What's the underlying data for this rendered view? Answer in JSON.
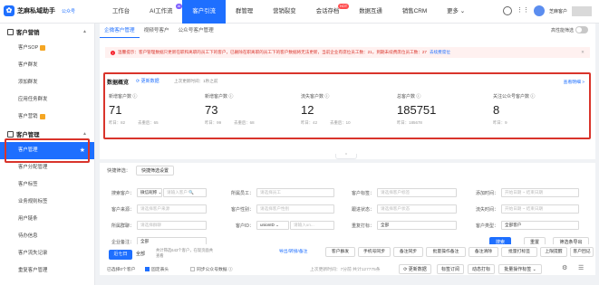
{
  "app": {
    "name": "芝麻私域助手",
    "subtitle": "公众号"
  },
  "nav": {
    "items": [
      {
        "label": "工作台"
      },
      {
        "label": "AI工作流",
        "badge": "AI"
      },
      {
        "label": "客户引流"
      },
      {
        "label": "群管理"
      },
      {
        "label": "营销裂变"
      },
      {
        "label": "会话存档",
        "badge": "HOT"
      },
      {
        "label": "数据互通"
      },
      {
        "label": "销售CRM"
      },
      {
        "label": "更多 ⌄"
      }
    ],
    "user_name": "芝麻客户"
  },
  "sidebar": {
    "group1": "客户营销",
    "group1_items": [
      "客户SOP",
      "客户群发",
      "添加群发",
      "应用任务群发",
      "客户营销"
    ],
    "group2": "客户管理",
    "group2_items": [
      "客户管理",
      "客户分配管理",
      "客户标签",
      "业务规则标签",
      "用户链条",
      "待办信息",
      "客户流失记录",
      "重复客户管理"
    ]
  },
  "tabs": [
    "企微客户管理",
    "视频号客户",
    "公众号客户管理"
  ],
  "toggle_label": "高性能筛选",
  "notice": {
    "text": "温馨提示：客户管理数据只更新在职和离职的员工下的客户，已删除在职离职的员工下的客户数据将无法更新，当前企业有席位员工数：21，到期未续费席位员工数：27",
    "link": "去续费席位"
  },
  "stats": {
    "title": "数据概览",
    "refresh": "更新数据",
    "updated": "上次更新时间：1秒之前",
    "view_more": "查看明细 >",
    "cards": [
      {
        "label": "新增客户数",
        "value": "71",
        "yesterday": "昨日：82",
        "sub2": "去重后：65"
      },
      {
        "label": "新增客户数",
        "value": "73",
        "yesterday": "昨日：99",
        "sub2": "去重后：68"
      },
      {
        "label": "流失客户数",
        "value": "12",
        "yesterday": "昨日：42",
        "sub2": "去重后：10"
      },
      {
        "label": "总客户数",
        "value": "185751",
        "yesterday": "昨日：185678",
        "sub2": ""
      },
      {
        "label": "关注公众号客户数",
        "value": "8",
        "yesterday": "昨日：9",
        "sub2": ""
      }
    ]
  },
  "filters": {
    "quick_label": "快捷筛选：",
    "quick_button": "快捷筛选设置",
    "search_label": "搜索客户：",
    "search_type": "微信昵称",
    "search_placeholder": "请输入客户",
    "owner_label": "所属员工：",
    "owner_placeholder": "请选择员工",
    "tag_label": "客户标签：",
    "tag_placeholder": "请选择客户标签",
    "add_time_label": "添加时间：",
    "date_start": "开始日期",
    "date_end": "结束日期",
    "source_label": "客户来源：",
    "source_placeholder": "请选择客户来源",
    "gender_label": "客户性别：",
    "gender_placeholder": "请选择客户性别",
    "stage_label": "跟进状态：",
    "stage_placeholder": "请选择客户状态",
    "lost_time_label": "流失时间：",
    "group_label": "所属群聊：",
    "group_value": "请选择群聊",
    "id_label": "客户ID：",
    "id_type": "unionID",
    "id_placeholder": "请输入un...",
    "dup_label": "重复打标：",
    "dup_value": "全部",
    "type_label": "客户类型：",
    "type_value": "全部客户",
    "remark_label": "企业备注：",
    "remark_value": "全部",
    "btn_search": "搜索",
    "btn_reset": "重置",
    "btn_export": "筛选条导出"
  },
  "table": {
    "seg_active": "近七日",
    "seg_all": "全部",
    "info": "共计筛选643个客户，在现页面共 查看",
    "actions": [
      "导出/转接/备注",
      "客户群发",
      "手机号同步",
      "备注同步",
      "批量操作备注",
      "备注清除",
      "批量打标签",
      "上限提醒",
      "客户回记"
    ],
    "selected_label": "已选择0个客户",
    "auto_refresh": "固定表头",
    "sync_label": "同步公众号数据",
    "last_update": "上次更新时间：7分前 共计127775条",
    "btn_refresh": "更新数据",
    "btn_tag": "标签订阅",
    "btn_move": "动态打标",
    "btn_bulk": "批量操作标签"
  }
}
